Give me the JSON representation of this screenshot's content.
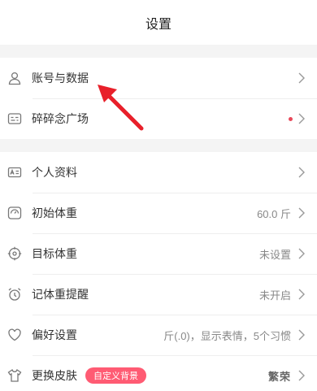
{
  "header": {
    "title": "设置"
  },
  "group1": [
    {
      "id": "account",
      "icon": "user-icon",
      "label": "账号与数据"
    },
    {
      "id": "square",
      "icon": "chat-icon",
      "label": "碎碎念广场",
      "has_dot": true
    }
  ],
  "group2": [
    {
      "id": "profile",
      "icon": "id-card-icon",
      "label": "个人资料",
      "value": ""
    },
    {
      "id": "initial-weight",
      "icon": "scale-icon",
      "label": "初始体重",
      "value": "60.0 斤"
    },
    {
      "id": "target-weight",
      "icon": "target-icon",
      "label": "目标体重",
      "value": "未设置"
    },
    {
      "id": "reminder",
      "icon": "alarm-icon",
      "label": "记体重提醒",
      "value": "未开启"
    },
    {
      "id": "preferences",
      "icon": "heart-icon",
      "label": "偏好设置",
      "value": "斤(.0)，显示表情，5个习惯"
    },
    {
      "id": "skin",
      "icon": "shirt-icon",
      "label": "更换皮肤",
      "badge": "自定义背景",
      "value": "繁荣"
    }
  ],
  "colors": {
    "accent": "#ff5b73",
    "annotation": "#e8202a",
    "dot": "#e8485a"
  }
}
